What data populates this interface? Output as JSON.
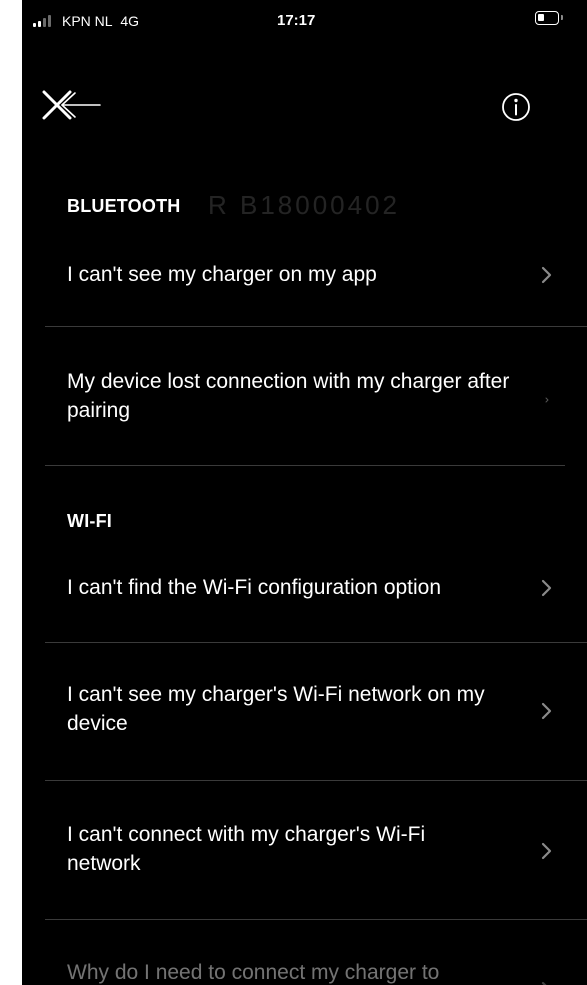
{
  "status_bar": {
    "carrier": "KPN NL",
    "network": "4G",
    "time": "17:17"
  },
  "toolbar": {
    "back_icon": "close-back-arrow-icon",
    "info_icon": "info-icon"
  },
  "sections": [
    {
      "title": "BLUETOOTH",
      "ghost_text": "R B18000402",
      "items": [
        {
          "label": "I can't see my charger on my app",
          "icon": "chevron-right-icon"
        },
        {
          "label": "My device lost connection with my charger after pairing",
          "icon": "chevron-right-icon"
        }
      ]
    },
    {
      "title": "WI-FI",
      "items": [
        {
          "label": "I can't find the Wi-Fi configuration option",
          "icon": "chevron-right-icon"
        },
        {
          "label": "I can't see my charger's Wi-Fi network on my device",
          "icon": "chevron-right-icon"
        },
        {
          "label": "I can't connect with my charger's Wi-Fi network",
          "icon": "chevron-right-icon"
        },
        {
          "label": "Why do I need to connect my charger to",
          "icon": "chevron-right-icon"
        }
      ]
    }
  ],
  "colors": {
    "background": "#000000",
    "text": "#ffffff",
    "chevron": "#8a8a8a",
    "divider": "#3a3a3a"
  }
}
